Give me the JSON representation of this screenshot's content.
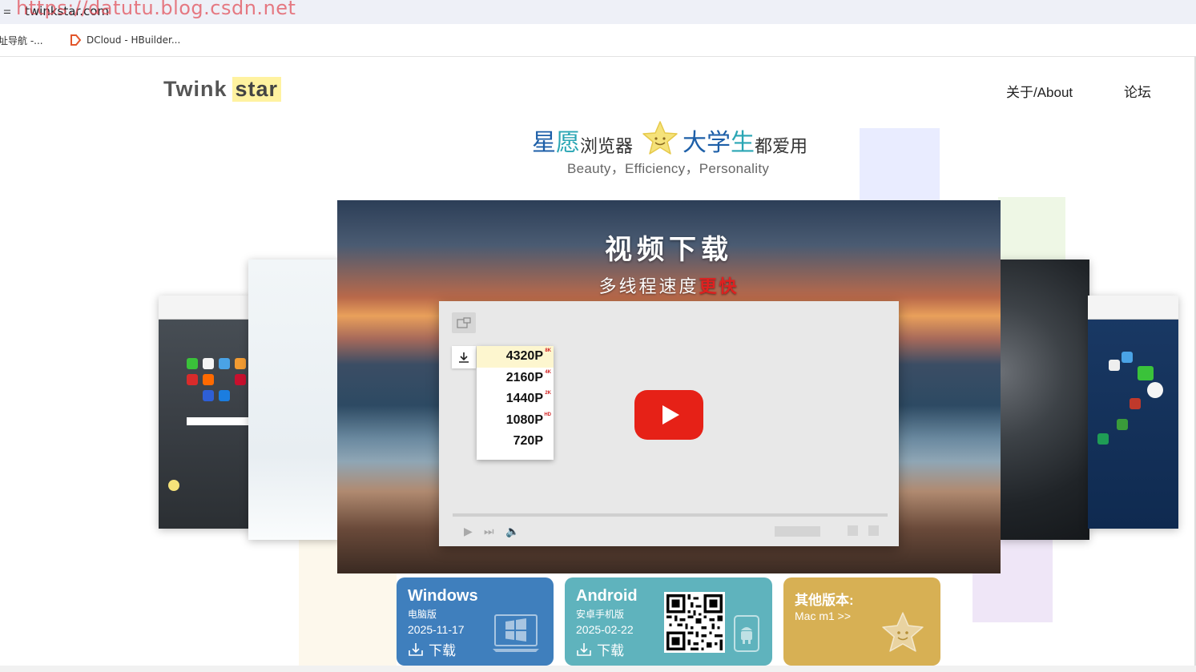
{
  "browser": {
    "url": "twinkstar.com",
    "watermark": "https://datutu.blog.csdn.net",
    "bookmarks": [
      {
        "label": "址导航 -..."
      },
      {
        "label": "DCloud - HBuilder..."
      }
    ]
  },
  "header": {
    "logo_left": "Twink",
    "logo_right": "star",
    "nav": [
      {
        "label": "关于/About"
      },
      {
        "label": "论坛"
      }
    ]
  },
  "slogan": {
    "part1": "星",
    "part2": "愿",
    "part3": "浏览器",
    "part4": "大",
    "part5": "学",
    "part6": "生",
    "part7": "都爱用",
    "subtitle": "Beauty，Efficiency，Personality"
  },
  "hero": {
    "title": "视频下载",
    "subtitle_prefix": "多线程速度",
    "subtitle_emphasis": "更快",
    "quality_options": [
      {
        "label": "4320P",
        "tag": "8K"
      },
      {
        "label": "2160P",
        "tag": "4K"
      },
      {
        "label": "1440P",
        "tag": "2K"
      },
      {
        "label": "1080P",
        "tag": "HD"
      },
      {
        "label": "720P",
        "tag": ""
      }
    ]
  },
  "downloads": {
    "windows": {
      "name": "Windows",
      "kind": "电脑版",
      "date": "2025-11-17",
      "action": "下载"
    },
    "android": {
      "name": "Android",
      "kind": "安卓手机版",
      "date": "2025-02-22",
      "action": "下载"
    },
    "other": {
      "name": "其他版本:",
      "mac": "Mac m1 >>"
    }
  },
  "colors": {
    "windows_card": "#3f7fbd",
    "android_card": "#5fb3bd",
    "other_card": "#d7b054",
    "youtube_red": "#e62117",
    "slogan_blue": "#1d5fa8",
    "slogan_teal": "#2aa6b4"
  },
  "icons": {
    "addr": "site-info-icon",
    "bookmark2": "dcloud-icon",
    "hero_pip": "picture-in-picture-icon",
    "hero_download": "download-icon",
    "hero_play": "youtube-play-icon"
  }
}
